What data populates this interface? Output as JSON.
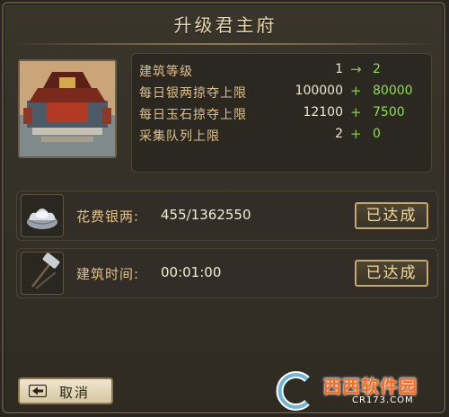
{
  "dialog": {
    "title": "升级君主府"
  },
  "stats": [
    {
      "label": "建筑等级",
      "current": "1",
      "symbol": "→",
      "new": "2"
    },
    {
      "label": "每日银两掠夺上限",
      "current": "100000",
      "symbol": "+",
      "new": "80000"
    },
    {
      "label": "每日玉石掠夺上限",
      "current": "12100",
      "symbol": "+",
      "new": "7500"
    },
    {
      "label": "采集队列上限",
      "current": "2",
      "symbol": "+",
      "new": "0"
    }
  ],
  "requirements": [
    {
      "label": "花费银两:",
      "value": "455/1362550",
      "status": "已达成",
      "icon": "silver-ingot-icon"
    },
    {
      "label": "建筑时间:",
      "value": "00:01:00",
      "status": "已达成",
      "icon": "hammer-icon"
    }
  ],
  "footer": {
    "cancel_label": "取消"
  },
  "watermark": {
    "brand": "西西软件园",
    "url": "CR173.COM"
  },
  "colors": {
    "accent_gold": "#e0c089",
    "increase_green": "#8ce04a",
    "panel_bg": "#2f2b23"
  }
}
